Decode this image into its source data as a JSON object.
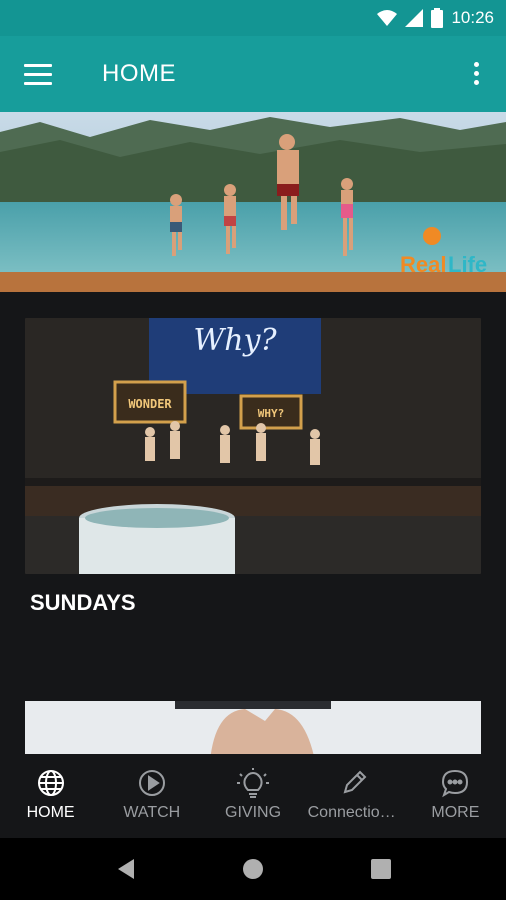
{
  "status_bar": {
    "time": "10:26",
    "icons": [
      "wifi-icon",
      "cellular-signal-icon",
      "battery-icon"
    ]
  },
  "app_bar": {
    "title": "HOME",
    "menu_icon": "hamburger-menu-icon",
    "overflow_icon": "more-vert-icon"
  },
  "hero": {
    "logo_text_1": "Real",
    "logo_text_2": "Life"
  },
  "cards": [
    {
      "title": "SUNDAYS",
      "image_signs": [
        "WONDER",
        "WHY?"
      ],
      "screen_text": "Why?"
    }
  ],
  "bottom_nav": {
    "items": [
      {
        "label": "HOME",
        "icon": "globe-icon",
        "active": true
      },
      {
        "label": "WATCH",
        "icon": "play-circle-icon",
        "active": false
      },
      {
        "label": "GIVING",
        "icon": "lightbulb-icon",
        "active": false
      },
      {
        "label": "Connection...",
        "icon": "pencil-icon",
        "active": false
      },
      {
        "label": "MORE",
        "icon": "chat-bubble-dots-icon",
        "active": false
      }
    ]
  },
  "colors": {
    "primary": "#179d9b",
    "status_bar": "#139593",
    "background": "#151618",
    "nav_inactive": "#9a9da1"
  }
}
